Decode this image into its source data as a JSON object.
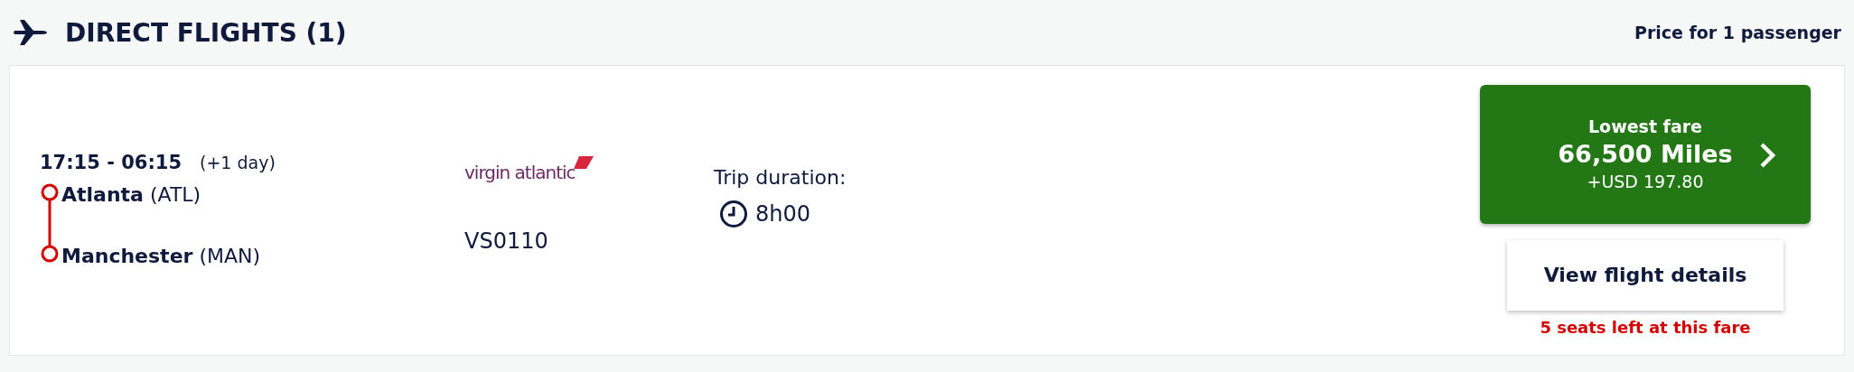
{
  "header": {
    "title": "DIRECT FLIGHTS (1)",
    "price_note": "Price for 1 passenger"
  },
  "flight": {
    "times": "17:15 - 06:15",
    "day_offset": "(+1 day)",
    "stops": [
      {
        "city": "Atlanta",
        "code": "(ATL)"
      },
      {
        "city": "Manchester",
        "code": "(MAN)"
      }
    ],
    "airline_logo": "virgin atlantic",
    "flight_number": "VS0110",
    "duration_label": "Trip duration:",
    "duration": "8h00"
  },
  "fare": {
    "label": "Lowest fare",
    "miles": "66,500 Miles",
    "cash": "+USD 197.80",
    "details_button": "View flight details",
    "seats_left": "5 seats left at this fare"
  }
}
